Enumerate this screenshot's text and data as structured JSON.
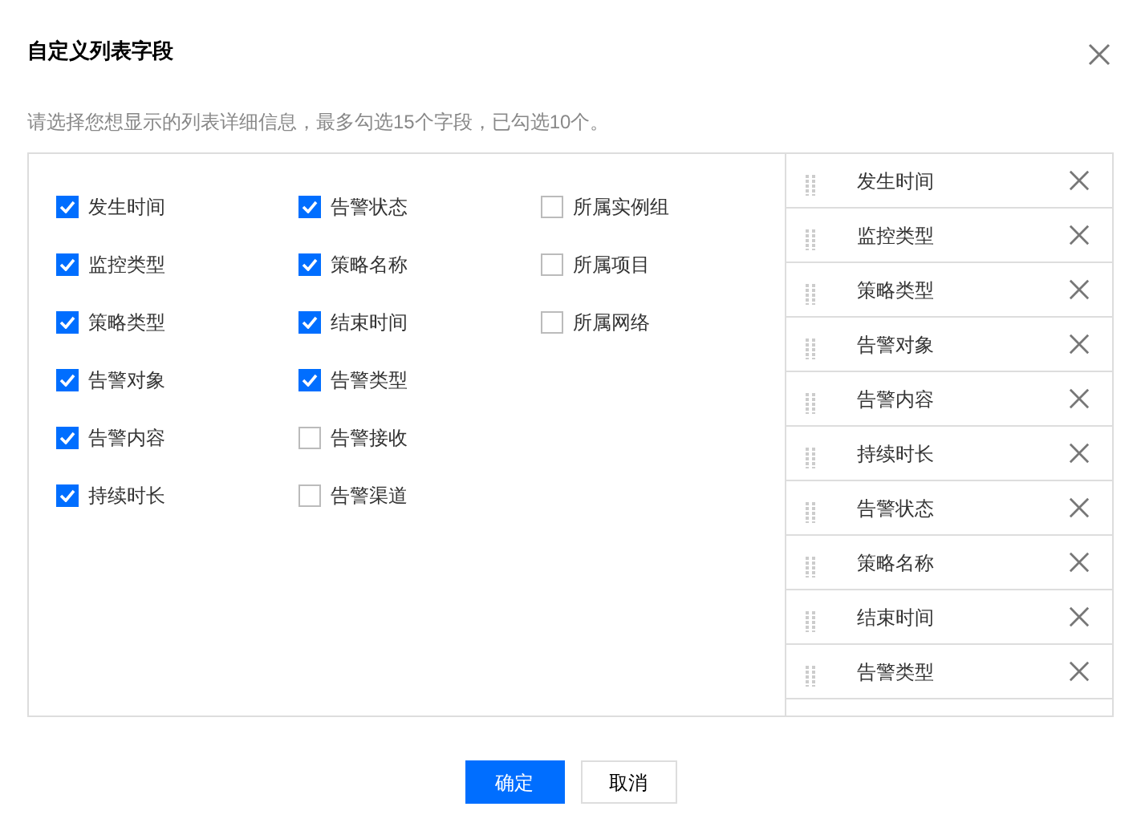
{
  "dialog": {
    "title": "自定义列表字段",
    "description": "请选择您想显示的列表详细信息，最多勾选15个字段，已勾选10个。"
  },
  "option_columns": [
    {
      "options": [
        {
          "label": "发生时间",
          "checked": true
        },
        {
          "label": "监控类型",
          "checked": true
        },
        {
          "label": "策略类型",
          "checked": true
        },
        {
          "label": "告警对象",
          "checked": true
        },
        {
          "label": "告警内容",
          "checked": true
        },
        {
          "label": "持续时长",
          "checked": true
        }
      ]
    },
    {
      "options": [
        {
          "label": "告警状态",
          "checked": true
        },
        {
          "label": "策略名称",
          "checked": true
        },
        {
          "label": "结束时间",
          "checked": true
        },
        {
          "label": "告警类型",
          "checked": true
        },
        {
          "label": "告警接收",
          "checked": false
        },
        {
          "label": "告警渠道",
          "checked": false
        }
      ]
    },
    {
      "options": [
        {
          "label": "所属实例组",
          "checked": false
        },
        {
          "label": "所属项目",
          "checked": false
        },
        {
          "label": "所属网络",
          "checked": false
        }
      ]
    }
  ],
  "selected_fields": [
    "发生时间",
    "监控类型",
    "策略类型",
    "告警对象",
    "告警内容",
    "持续时长",
    "告警状态",
    "策略名称",
    "结束时间",
    "告警类型"
  ],
  "buttons": [
    {
      "label": "确定",
      "kind": "primary"
    },
    {
      "label": "取消",
      "kind": "secondary"
    }
  ]
}
